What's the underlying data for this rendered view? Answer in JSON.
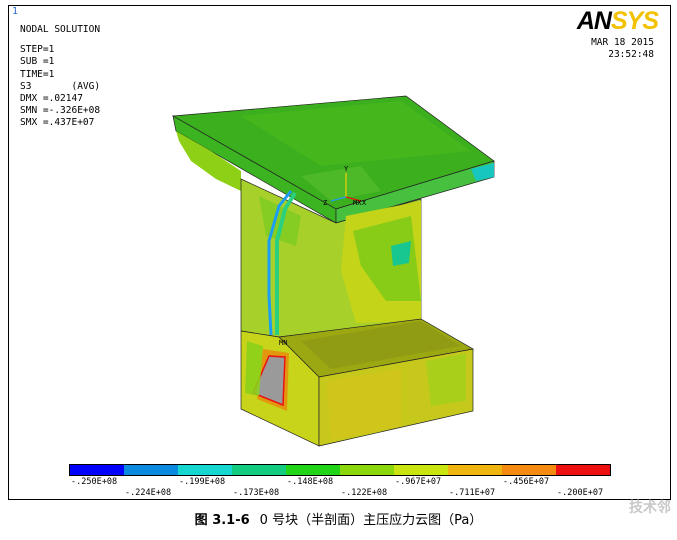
{
  "window_number": "1",
  "solution": {
    "title": "NODAL SOLUTION",
    "step": "STEP=1",
    "sub": "SUB =1",
    "time": "TIME=1",
    "item": "S3       (AVG)",
    "dmx": "DMX =.02147",
    "smn": "SMN =-.326E+08",
    "smx": "SMX =.437E+07"
  },
  "brand": {
    "part1": "AN",
    "part2": "SYS"
  },
  "timestamp": {
    "date": "MAR 18 2015",
    "time": "23:52:48"
  },
  "axis_labels": {
    "y": "Y",
    "z": "Z",
    "x": "X",
    "mn": "MN",
    "mx": "MX"
  },
  "legend": {
    "colors": [
      "#0000ff",
      "#0b8be0",
      "#16d6d0",
      "#12cc80",
      "#22d418",
      "#8ad80c",
      "#c9e410",
      "#eeb410",
      "#f48a10",
      "#ee1010"
    ],
    "upper_labels": [
      "-.250E+08",
      "-.199E+08",
      "-.148E+08",
      "-.967E+07",
      "-.456E+07"
    ],
    "lower_labels": [
      "-.224E+08",
      "-.173E+08",
      "-.122E+08",
      "-.711E+07",
      "-.200E+07"
    ]
  },
  "caption": {
    "figure_no": "图 3.1-6",
    "text": "0 号块（半剖面）主压应力云图（Pa）"
  },
  "watermark": "技术邻"
}
